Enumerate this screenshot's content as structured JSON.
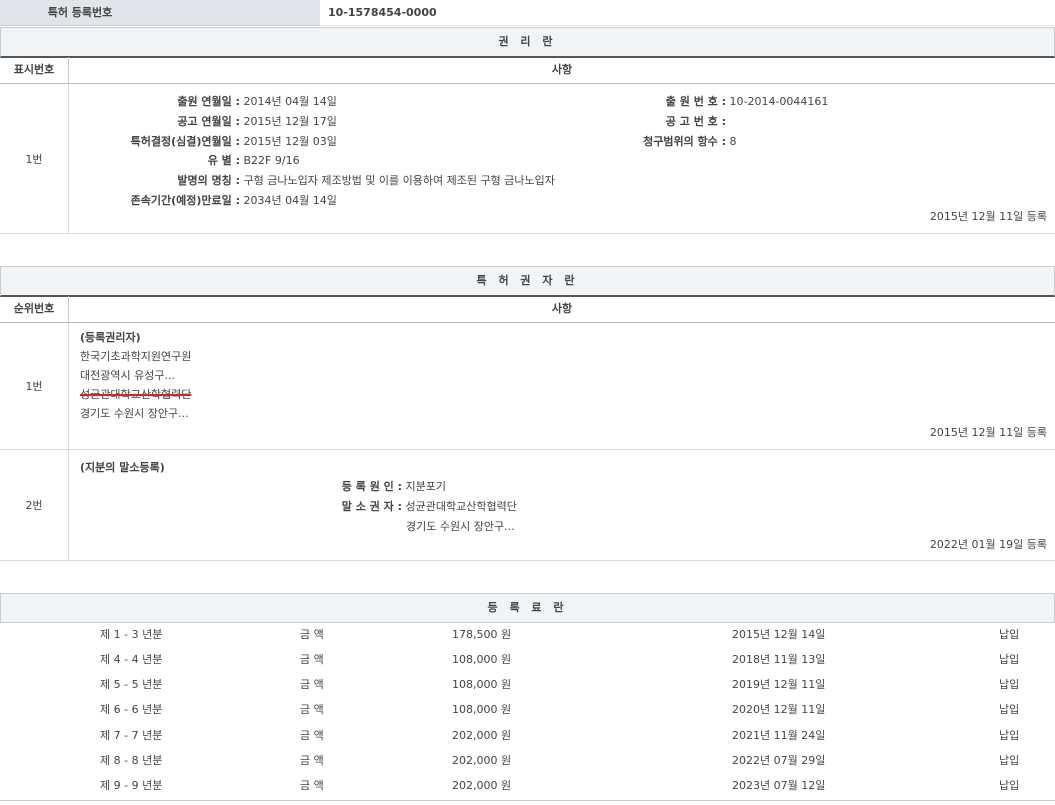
{
  "top": {
    "label": "특허 등록번호",
    "value": "10-1578454-0000"
  },
  "rights": {
    "title": "권 리 란",
    "col_num": "표시번호",
    "col_item": "사항",
    "row": {
      "num": "1번",
      "left": [
        {
          "k": "출원 연월일 :",
          "v": "2014년 04월 14일"
        },
        {
          "k": "공고 연월일 :",
          "v": "2015년 12월 17일"
        },
        {
          "k": "특허결정(심결)연월일 :",
          "v": "2015년 12월 03일"
        },
        {
          "k": "유 별 :",
          "v": "B22F 9/16"
        },
        {
          "k": "발명의 명칭 :",
          "v": "구형 금나노입자 제조방법 및 이를 이용하여 제조된 구형 금나노입자"
        },
        {
          "k": "존속기간(예정)만료일 :",
          "v": "2034년 04월 14일"
        }
      ],
      "right": [
        {
          "k": "출 원 번 호 :",
          "v": "10-2014-0044161"
        },
        {
          "k": "공 고 번 호 :",
          "v": ""
        },
        {
          "k": "청구범위의 항수 :",
          "v": "8"
        }
      ],
      "reg_date": "2015년 12월 11일 등록"
    }
  },
  "holders": {
    "title": "특 허 권 자 란",
    "col_num": "순위번호",
    "col_item": "사항",
    "row1": {
      "num": "1번",
      "head": "(등록권리자)",
      "lines": [
        "한국기초과학지원연구원",
        "대전광역시 유성구...",
        "성균관대학교산학협력단",
        "경기도 수원시 장안구..."
      ],
      "reg_date": "2015년 12월 11일 등록"
    },
    "row2": {
      "num": "2번",
      "head": "(지분의 말소등록)",
      "cause_k": "등 록 원 인 :",
      "cause_v": "지분포기",
      "holder_k": "말 소 권 자 :",
      "holder_v": "성균관대학교산학협력단",
      "holder_addr": "경기도 수원시 장안구...",
      "reg_date": "2022년 01월 19일 등록"
    }
  },
  "fees": {
    "title": "등 록 료 란",
    "amount_label": "금 액",
    "rows": [
      {
        "period": "제 1 - 3 년분",
        "amount": "178,500 원",
        "date": "2015년 12월 14일",
        "status": "납입"
      },
      {
        "period": "제 4 - 4 년분",
        "amount": "108,000 원",
        "date": "2018년 11월 13일",
        "status": "납입"
      },
      {
        "period": "제 5 - 5 년분",
        "amount": "108,000 원",
        "date": "2019년 12월 11일",
        "status": "납입"
      },
      {
        "period": "제 6 - 6 년분",
        "amount": "108,000 원",
        "date": "2020년 12월 11일",
        "status": "납입"
      },
      {
        "period": "제 7 - 7 년분",
        "amount": "202,000 원",
        "date": "2021년 11월 24일",
        "status": "납입"
      },
      {
        "period": "제 8 - 8 년분",
        "amount": "202,000 원",
        "date": "2022년 07월 29일",
        "status": "납입"
      },
      {
        "period": "제 9 - 9 년분",
        "amount": "202,000 원",
        "date": "2023년 07월 12일",
        "status": "납입"
      }
    ]
  }
}
